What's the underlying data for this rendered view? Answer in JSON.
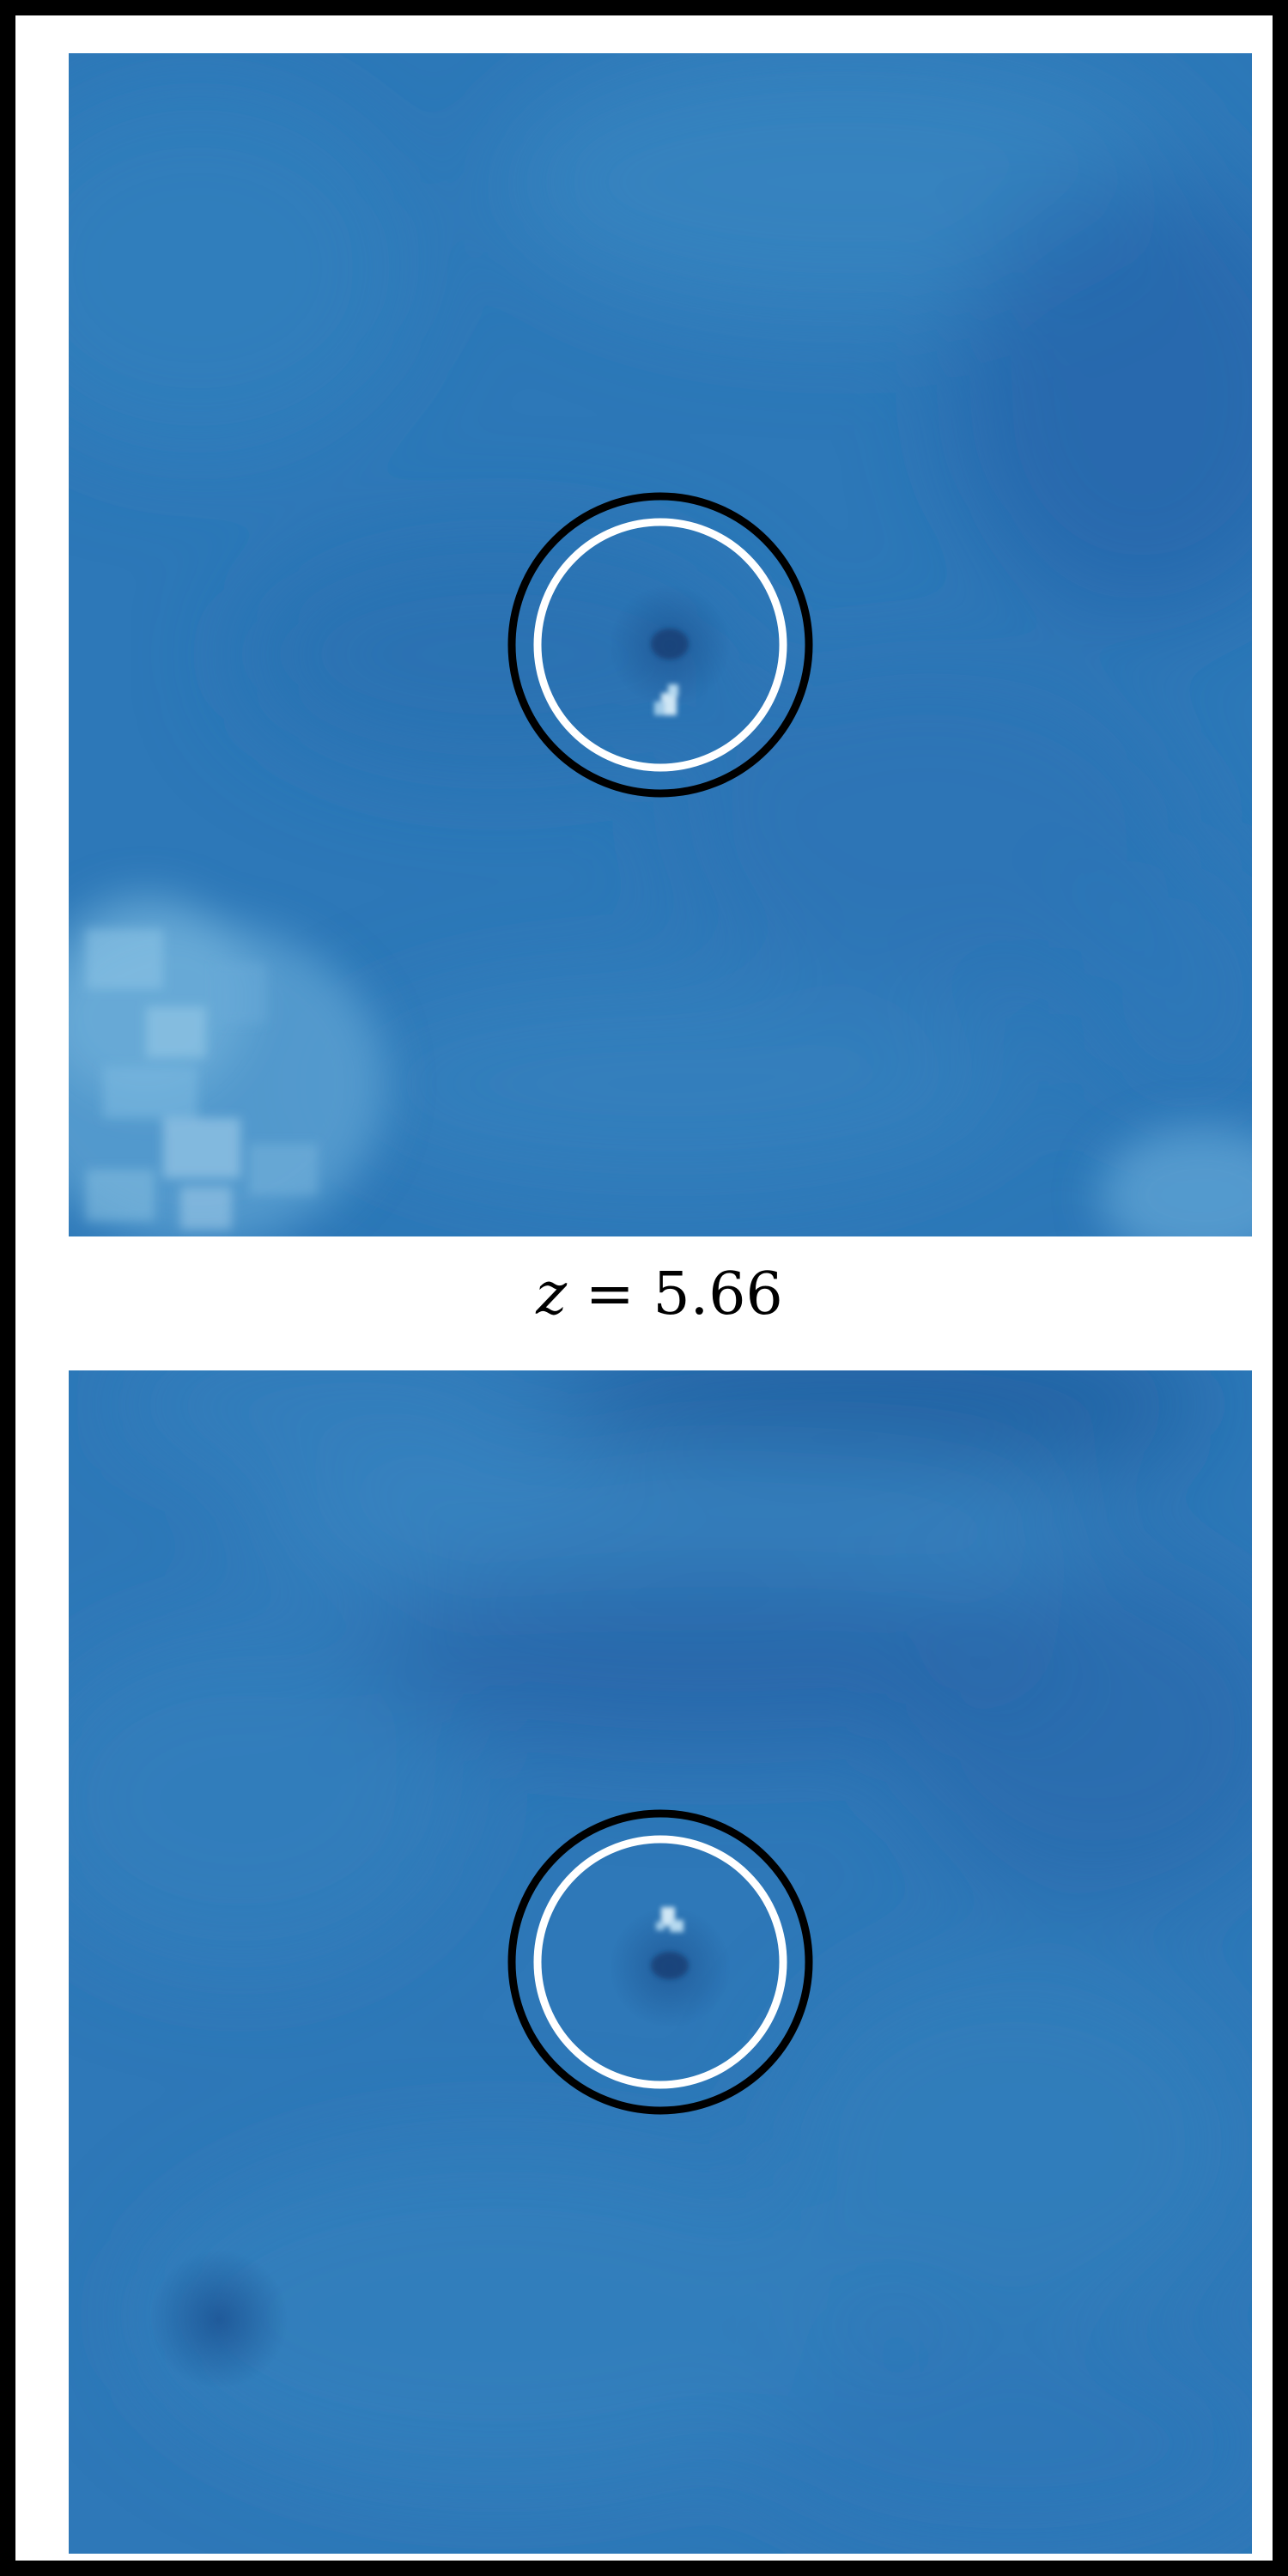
{
  "figure": {
    "label_variable": "z",
    "label_operator": "=",
    "label_value": "5.66",
    "colors": {
      "background_blue": "#2f79b8",
      "dark_blue": "#1e5a9c",
      "light_blue": "#8fc3e3",
      "circle_outer": "#000000",
      "circle_inner": "#ffffff",
      "frame": "#000000"
    }
  }
}
